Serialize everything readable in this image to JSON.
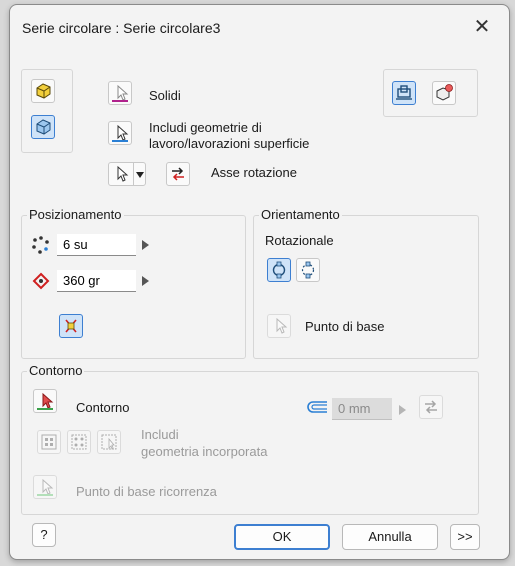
{
  "title": "Serie circolare : Serie circolare3",
  "selection": {
    "solids_label": "Solidi",
    "include_geometry_label_1": "Includi geometrie di",
    "include_geometry_label_2": "lavoro/lavorazioni superficie",
    "axis_label": "Asse rotazione"
  },
  "placement": {
    "group_label": "Posizionamento",
    "count_value": "6 su",
    "angle_value": "360 gr"
  },
  "orientation": {
    "group_label": "Orientamento",
    "rotational_label": "Rotazionale",
    "base_point_label": "Punto di base"
  },
  "boundary": {
    "group_label": "Contorno",
    "boundary_label": "Contorno",
    "offset_value": "0 mm",
    "include_embedded_1": "Includi",
    "include_embedded_2": "geometria incorporata",
    "base_point_recurrence_label": "Punto di base ricorrenza"
  },
  "footer": {
    "ok_label": "OK",
    "cancel_label": "Annulla",
    "more_label": ">>",
    "help_icon": "?"
  },
  "colors": {
    "accent": "#3d7fd1",
    "solids_underline": "#b0228c",
    "geometry_underline": "#2a7fd4",
    "boundary_underline": "#3aa14a"
  }
}
